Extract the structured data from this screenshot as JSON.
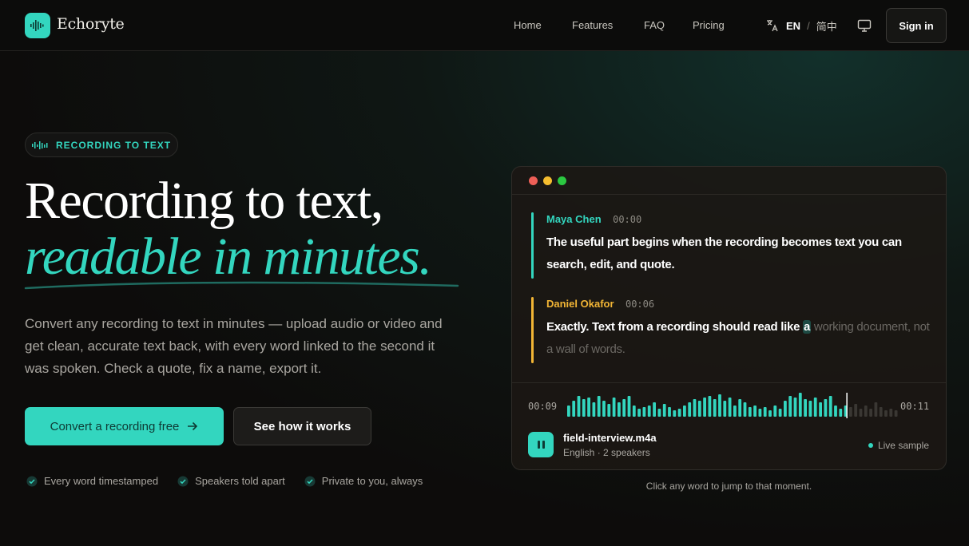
{
  "brand": {
    "name": "Echoryte"
  },
  "nav": {
    "links": [
      "Home",
      "Features",
      "FAQ",
      "Pricing"
    ],
    "lang_current": "EN",
    "lang_sep": "/",
    "lang_alt": "简中",
    "signin": "Sign in"
  },
  "hero": {
    "eyebrow": "RECORDING TO TEXT",
    "title_line1": "Recording to text,",
    "title_line2": "readable in minutes.",
    "description": "Convert any recording to text in minutes — upload audio or video and get clean, accurate text back, with every word linked to the second it was spoken. Check a quote, fix a name, export it.",
    "cta_primary": "Convert a recording free",
    "cta_secondary": "See how it works",
    "features": [
      "Every word timestamped",
      "Speakers told apart",
      "Private to you, always"
    ]
  },
  "transcript": {
    "segments": [
      {
        "speaker": "Maya Chen",
        "time": "00:00",
        "color": "#33d6bf",
        "text": "The useful part begins when the recording becomes text you can search, edit, and quote."
      },
      {
        "speaker": "Daniel Okafor",
        "time": "00:06",
        "color": "#f2b535",
        "text_spoken": "Exactly. Text from a recording should read like",
        "text_current": "a",
        "text_upcoming": "working document, not a wall of words."
      }
    ],
    "player": {
      "time_current": "00:09",
      "time_total": "00:11",
      "progress": 0.84,
      "file_name": "field-interview.m4a",
      "file_meta": "English · 2 speakers",
      "badge": "Live sample"
    },
    "caption": "Click any word to jump to that moment."
  },
  "colors": {
    "accent": "#33d6bf",
    "speaker2": "#f2b535",
    "background": "#0d0c0b"
  }
}
